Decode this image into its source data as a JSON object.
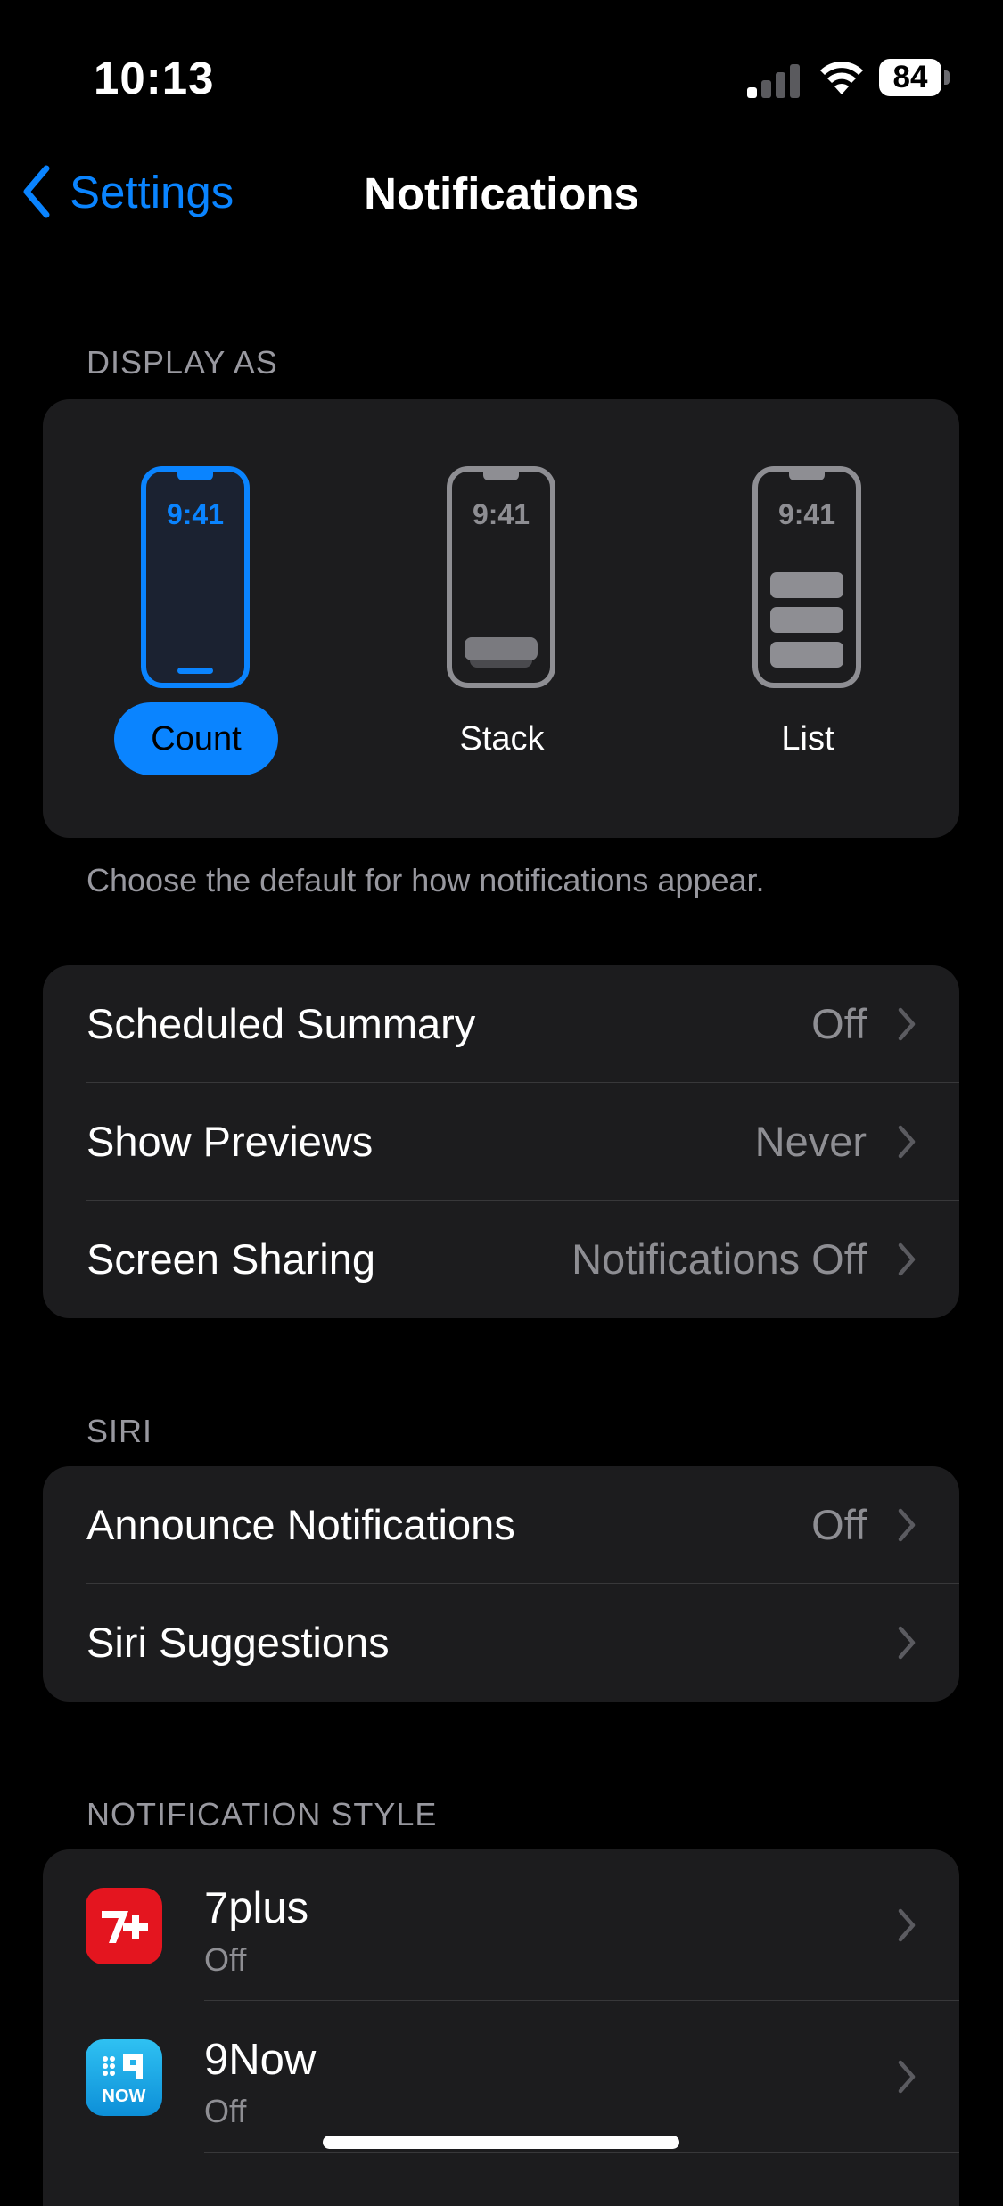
{
  "status_bar": {
    "time": "10:13",
    "battery": "84"
  },
  "nav": {
    "back_label": "Settings",
    "title": "Notifications"
  },
  "display_as": {
    "header": "DISPLAY AS",
    "options": [
      {
        "label": "Count",
        "preview_time": "9:41",
        "selected": true
      },
      {
        "label": "Stack",
        "preview_time": "9:41",
        "selected": false
      },
      {
        "label": "List",
        "preview_time": "9:41",
        "selected": false
      }
    ],
    "footer": "Choose the default for how notifications appear."
  },
  "general": {
    "rows": [
      {
        "label": "Scheduled Summary",
        "value": "Off"
      },
      {
        "label": "Show Previews",
        "value": "Never"
      },
      {
        "label": "Screen Sharing",
        "value": "Notifications Off"
      }
    ]
  },
  "siri": {
    "header": "SIRI",
    "rows": [
      {
        "label": "Announce Notifications",
        "value": "Off"
      },
      {
        "label": "Siri Suggestions",
        "value": ""
      }
    ]
  },
  "notification_style": {
    "header": "NOTIFICATION STYLE",
    "apps": [
      {
        "name": "7plus",
        "status": "Off",
        "icon": "7plus-app-icon",
        "icon_text": "7+",
        "color": "#e4151f"
      },
      {
        "name": "9Now",
        "status": "Off",
        "icon": "9now-app-icon",
        "icon_text": "NOW",
        "color": "#1aa3e8"
      }
    ]
  },
  "colors": {
    "accent": "#0a84ff",
    "background": "#000000",
    "card": "#1c1c1e",
    "secondary_text": "#8e8e93"
  }
}
